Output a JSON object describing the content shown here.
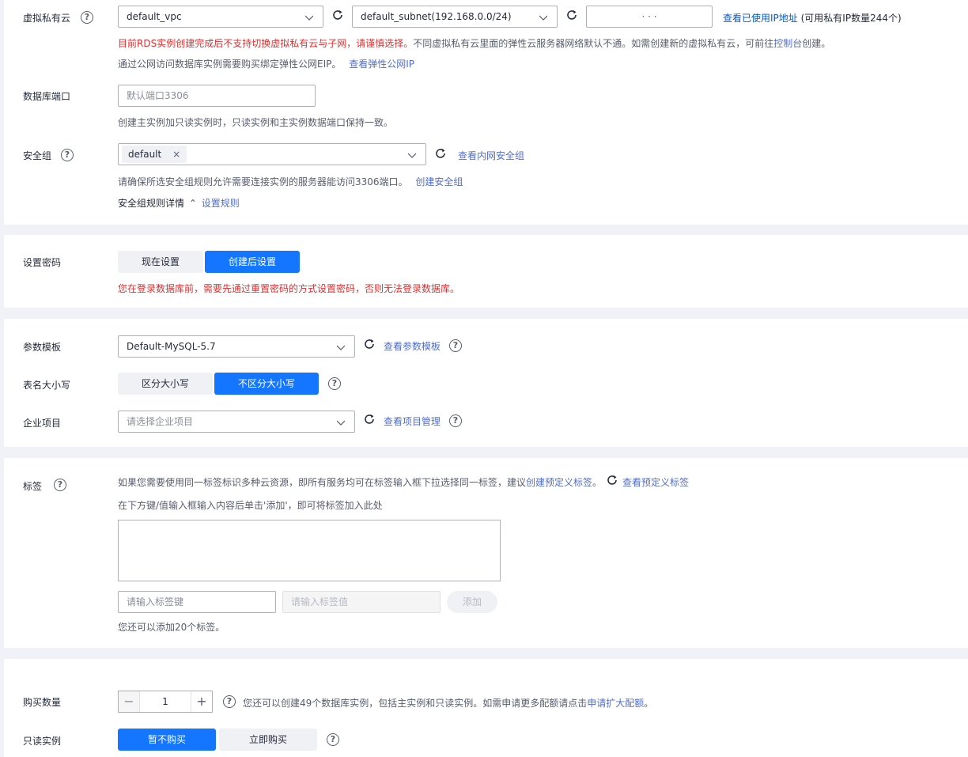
{
  "network": {
    "vpc_label": "虚拟私有云",
    "vpc_value": "default_vpc",
    "subnet_value": "default_subnet(192.168.0.0/24)",
    "ip_dots": "·          ·          ·",
    "view_ip_link": "查看已使用IP地址",
    "ip_available": "(可用私有IP数量244个)",
    "warning_text": "目前RDS实例创建完成后不支持切换虚拟私有云与子网，请谨慎选择。",
    "info_text_1": "不同虚拟私有云里面的弹性云服务器网络默认不通。如需创建新的虚拟私有云，可前往",
    "console_link": "控制台",
    "info_text_2": "创建。",
    "eip_text": "通过公网访问数据库实例需要购买绑定弹性公网EIP。",
    "eip_link": "查看弹性公网IP",
    "port_label": "数据库端口",
    "port_placeholder": "默认端口3306",
    "port_hint": "创建主实例加只读实例时，只读实例和主实例数据端口保持一致。",
    "sg_label": "安全组",
    "sg_chip": "default",
    "sg_view_link": "查看内网安全组",
    "sg_hint": "请确保所选安全组规则允许需要连接实例的服务器能访问3306端口。",
    "sg_create_link": "创建安全组",
    "sg_rules_label": "安全组规则详情",
    "sg_rules_link": "设置规则"
  },
  "password": {
    "label": "设置密码",
    "opt_now": "现在设置",
    "opt_later": "创建后设置",
    "warning": "您在登录数据库前，需要先通过重置密码的方式设置密码，否则无法登录数据库。"
  },
  "params": {
    "template_label": "参数模板",
    "template_value": "Default-MySQL-5.7",
    "template_link": "查看参数模板",
    "case_label": "表名大小写",
    "case_sensitive": "区分大小写",
    "case_insensitive": "不区分大小写",
    "project_label": "企业项目",
    "project_placeholder": "请选择企业项目",
    "project_link": "查看项目管理"
  },
  "tags": {
    "label": "标签",
    "desc_1": "如果您需要使用同一标签标识多种云资源，即所有服务均可在标签输入框下拉选择同一标签，建议",
    "create_link": "创建预定义标签",
    "desc_2": "。",
    "view_link": "查看预定义标签",
    "instruction": "在下方键/值输入框输入内容后单击'添加'，即可将标签加入此处",
    "key_placeholder": "请输入标签键",
    "value_placeholder": "请输入标签值",
    "add_button": "添加",
    "remaining": "您还可以添加20个标签。"
  },
  "purchase": {
    "qty_label": "购买数量",
    "qty_minus": "−",
    "qty_value": "1",
    "qty_plus": "+",
    "qty_hint": "您还可以创建49个数据库实例，包括主实例和只读实例。如需申请更多配额请点击",
    "quota_link": "申请扩大配额",
    "qty_hint_end": "。",
    "readonly_label": "只读实例",
    "opt_no": "暂不购买",
    "opt_now": "立即购买"
  },
  "colors": {
    "accent": "#1476ff",
    "link": "#526ecc",
    "warning": "#e02e2e",
    "page_bg": "#f0f2f7"
  }
}
